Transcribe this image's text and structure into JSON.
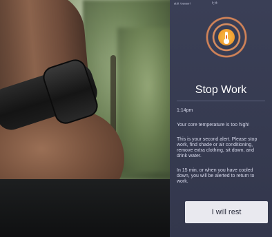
{
  "status_bar": {
    "carrier": "ᵃᵗ⁸ᵗ ⁽ˢᵉⁿˢᵒʳ⁾",
    "time": "ᵏ:ᵏᵏ"
  },
  "alert": {
    "icon": "thermometer-icon",
    "title": "Stop Work",
    "time": "1:14pm",
    "lines": [
      "Your core temperature is too high!",
      "This is your second alert. Please stop\nwork, find shade or air conditioning,\nremove extra clothing, sit down, and\ndrink water.",
      "In 15 min, or when you have cooled\ndown, you will be alerted to return to\nwork."
    ],
    "button_label": "I will rest"
  },
  "colors": {
    "phone_background": "#3a3f56",
    "accent_orange": "#f2a233",
    "button_background": "#e9e9ef"
  }
}
